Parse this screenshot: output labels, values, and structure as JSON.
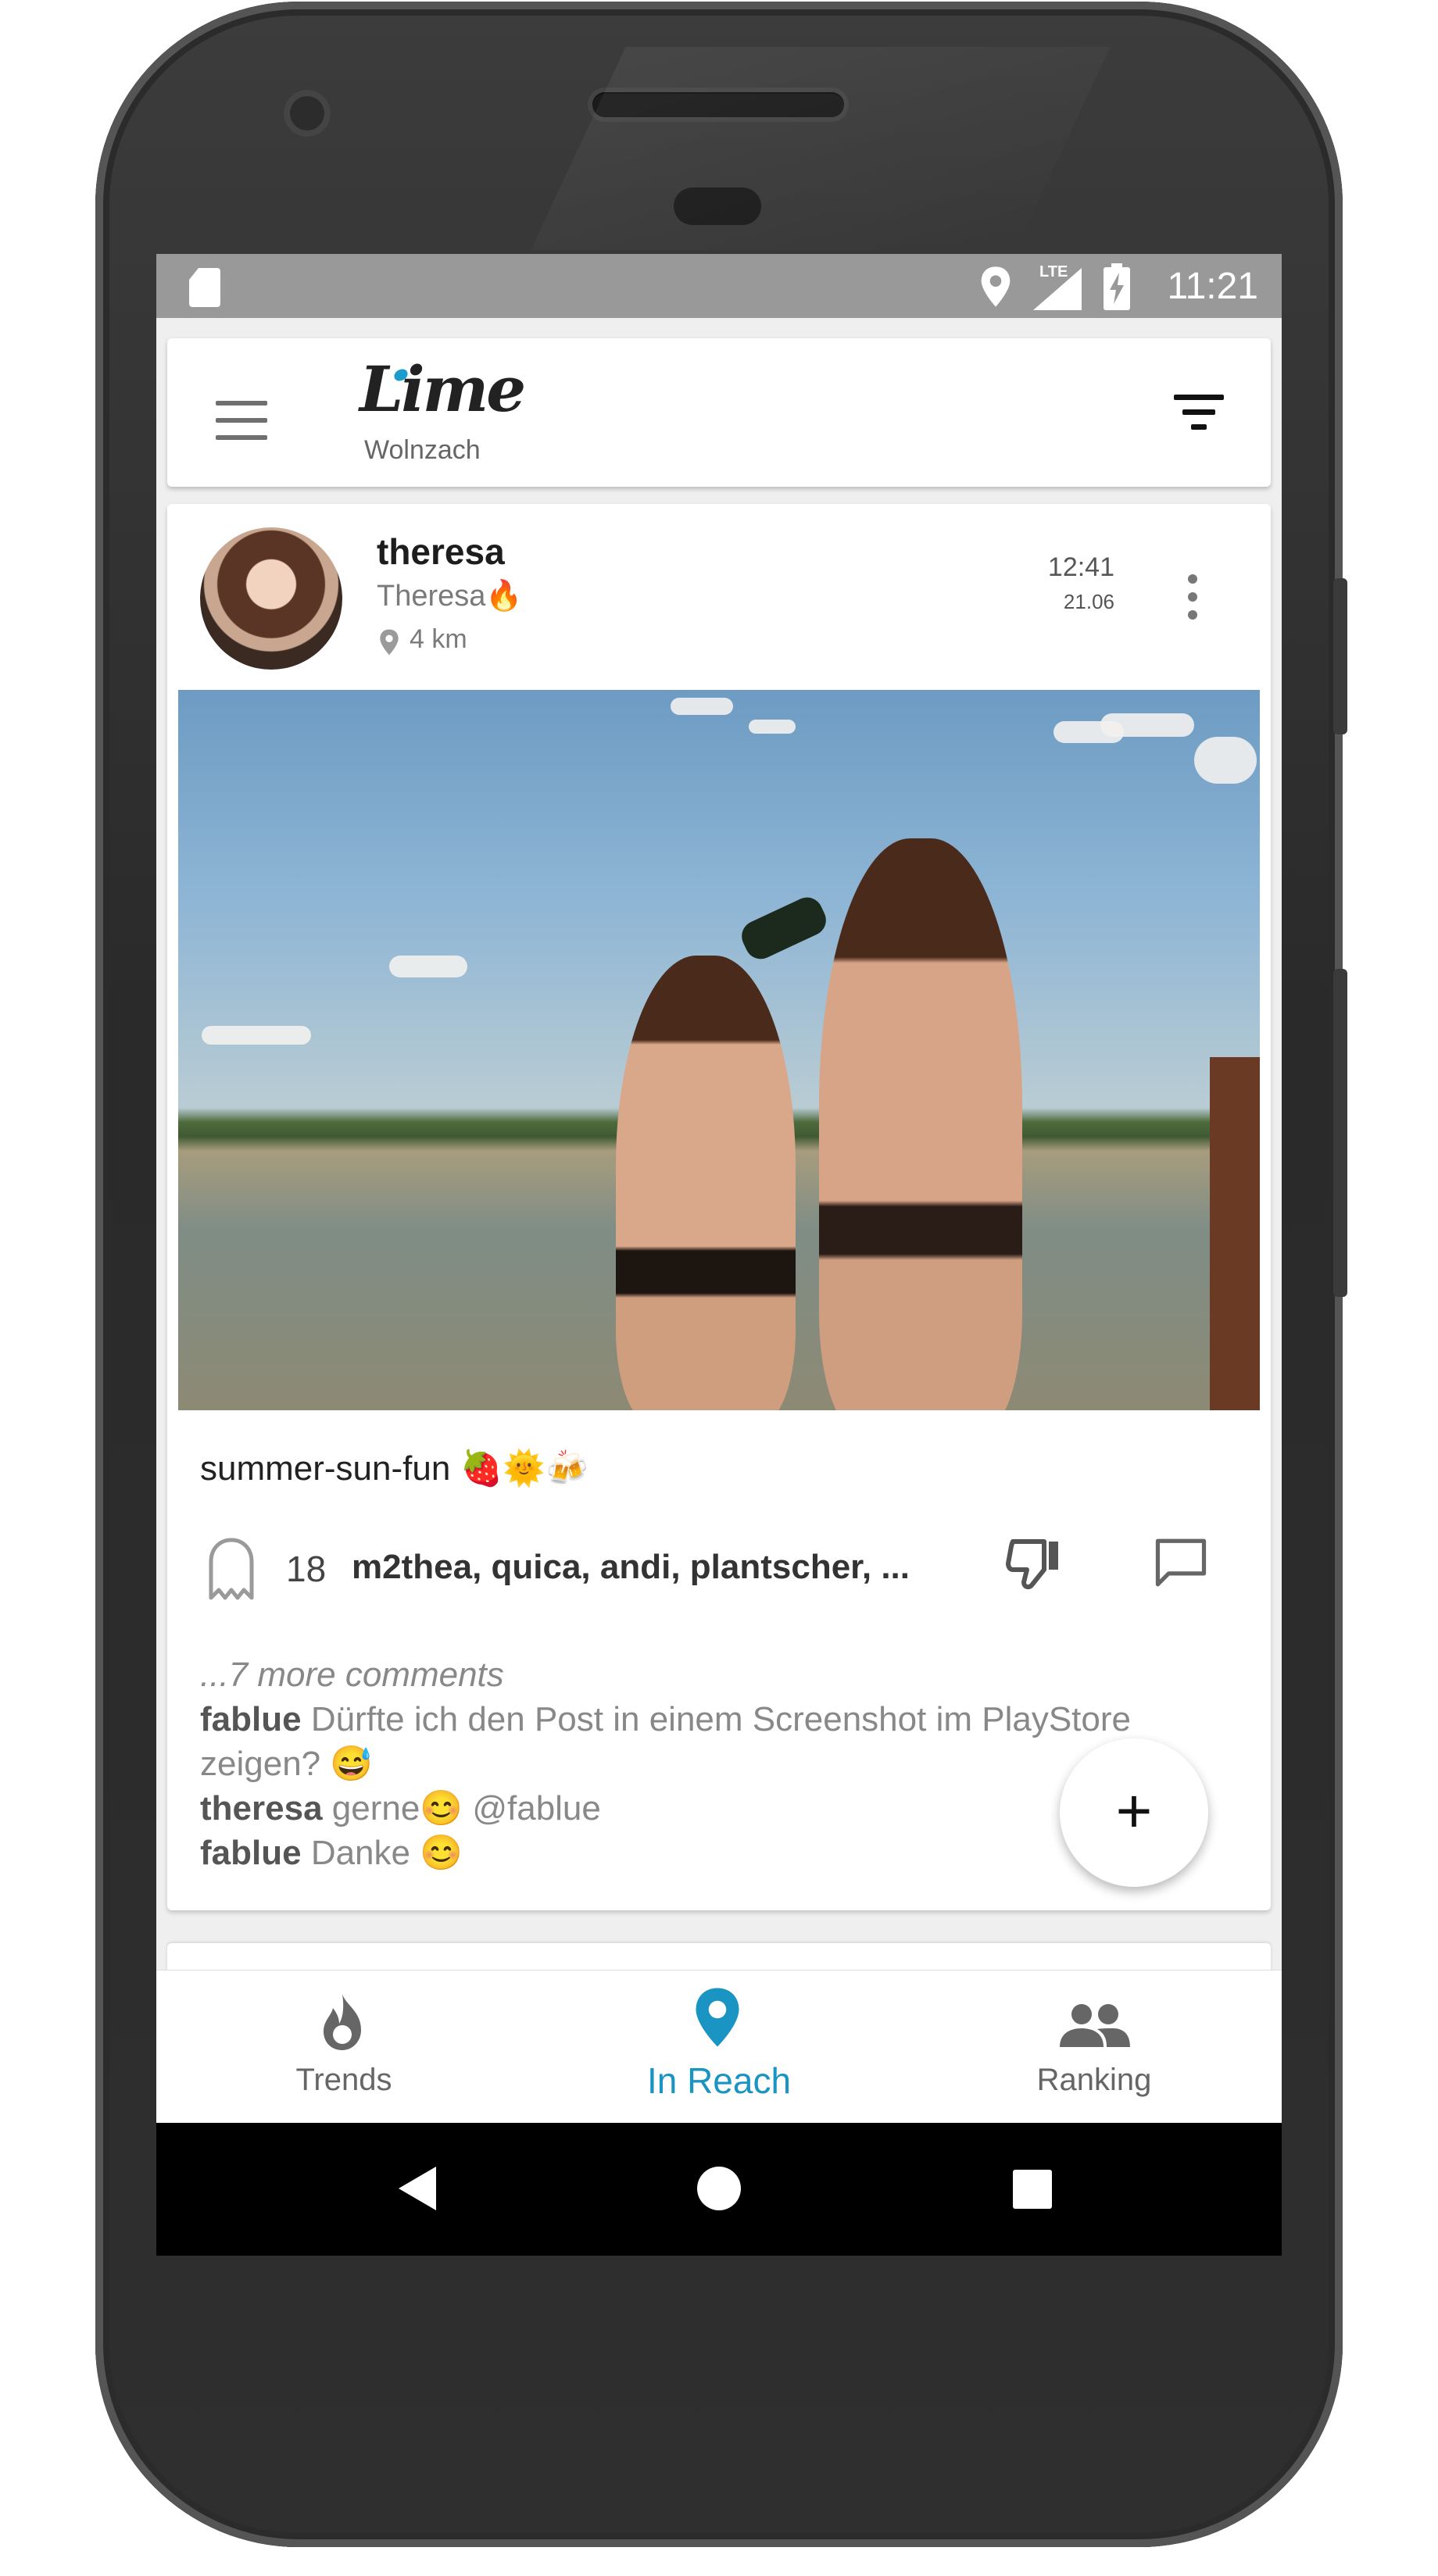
{
  "status_bar": {
    "time": "11:21",
    "network": "LTE"
  },
  "app_bar": {
    "logo": "Lime",
    "location": "Wolnzach"
  },
  "post": {
    "username": "theresa",
    "display_name": "Theresa🔥",
    "distance": "4 km",
    "time": "12:41",
    "date": "21.06",
    "caption": "summer-sun-fun 🍓🌞🍻",
    "like_count": "18",
    "likers": "m2thea, quica, andi, plantscher, ...",
    "more_comments": "...7 more comments",
    "comments": [
      {
        "user": "fablue",
        "text": "Dürfte ich den Post in einem Screenshot im PlayStore zeigen? 😅"
      },
      {
        "user": "theresa",
        "text": "gerne😊 @fablue"
      },
      {
        "user": "fablue",
        "text": "Danke 😊"
      }
    ]
  },
  "fab": {
    "label": "+"
  },
  "bottom_nav": {
    "items": [
      {
        "label": "Trends",
        "icon": "flame-icon",
        "active": false
      },
      {
        "label": "In Reach",
        "icon": "location-pin-icon",
        "active": true
      },
      {
        "label": "Ranking",
        "icon": "people-icon",
        "active": false
      }
    ]
  },
  "colors": {
    "accent": "#1a94c3",
    "status_bar": "#999999",
    "nav_inactive": "#666666"
  }
}
